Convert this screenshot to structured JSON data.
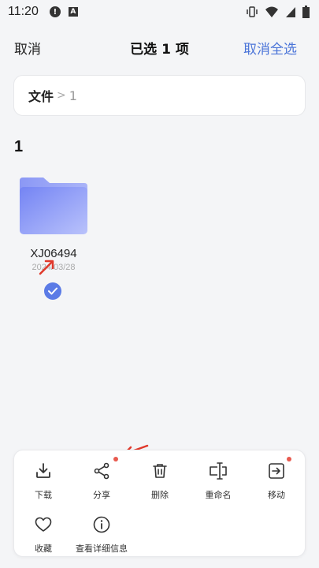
{
  "status_bar": {
    "time": "11:20",
    "notif_glyph": "!",
    "app_glyph": "A",
    "icons": [
      "vibrate-icon",
      "wifi-icon",
      "signal-icon",
      "battery-icon"
    ]
  },
  "header": {
    "cancel_label": "取消",
    "title": "已选 1 项",
    "deselect_all_label": "取消全选"
  },
  "breadcrumb": {
    "root": "文件",
    "separator": ">",
    "current": "1"
  },
  "section": {
    "title": "1"
  },
  "folder": {
    "name": "XJ06494",
    "date": "2024/03/28",
    "selected": true,
    "color": "#7f92f5"
  },
  "actions": {
    "row1": [
      {
        "label": "下载",
        "icon": "download-icon"
      },
      {
        "label": "分享",
        "icon": "share-icon"
      },
      {
        "label": "删除",
        "icon": "trash-icon"
      },
      {
        "label": "重命名",
        "icon": "rename-icon"
      },
      {
        "label": "移动",
        "icon": "move-icon"
      }
    ],
    "row2": [
      {
        "label": "收藏",
        "icon": "heart-icon"
      },
      {
        "label": "查看详细信息",
        "icon": "info-icon"
      }
    ]
  },
  "colors": {
    "accent": "#4a74d8",
    "badge": "#5b7be6",
    "dot": "#e85a4f",
    "annotation_arrow": "#e0392b"
  }
}
